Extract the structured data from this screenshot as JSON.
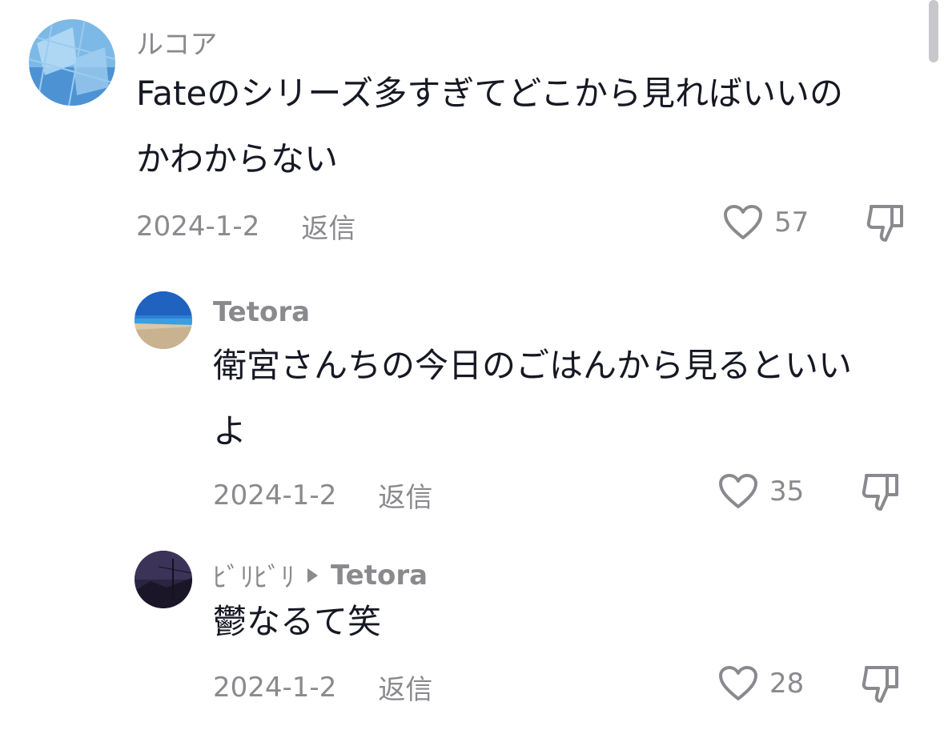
{
  "comments": [
    {
      "username": "ルコア",
      "text_line1": "Fateのシリーズ多すぎてどこから見ればいいの",
      "text_line2": "かわからない",
      "date": "2024-1-2",
      "reply_label": "返信",
      "likes": "57"
    },
    {
      "username": "Tetora",
      "text_line1": "衛宮さんちの今日のごはんから見るといい",
      "text_line2": "よ",
      "date": "2024-1-2",
      "reply_label": "返信",
      "likes": "35"
    },
    {
      "username": "ﾋﾞﾘﾋﾞﾘ",
      "reply_to": "Tetora",
      "text_line1": "鬱なるて笑",
      "date": "2024-1-2",
      "reply_label": "返信",
      "likes": "28"
    }
  ],
  "icons": {
    "like": "heart-outline-icon",
    "dislike": "thumbs-down-outline-icon"
  },
  "colors": {
    "text": "#161823",
    "muted": "#8a8a8e",
    "background": "#ffffff"
  }
}
